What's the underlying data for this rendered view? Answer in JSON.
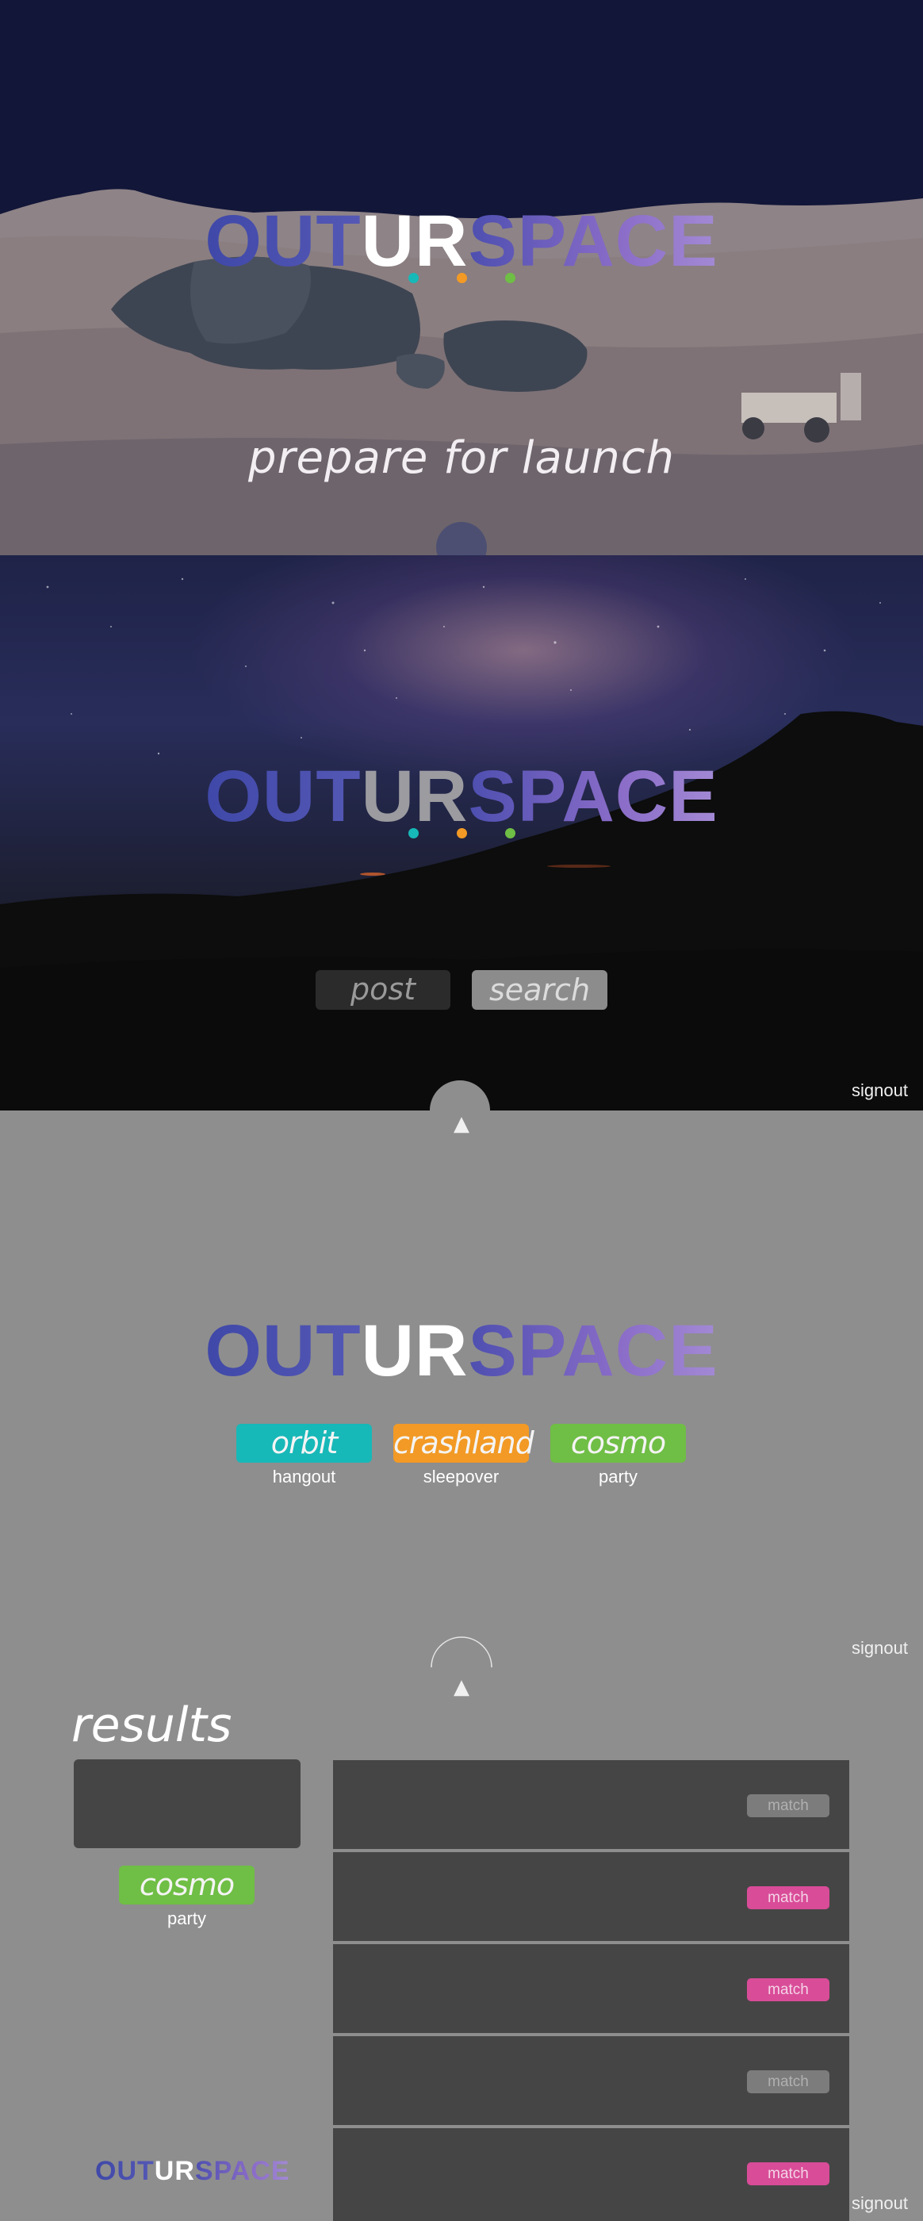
{
  "logo": {
    "part1": "OUT",
    "part2": "UR",
    "part3": "SPACE"
  },
  "colors": {
    "teal": "#17b8b8",
    "orange": "#f29a25",
    "green": "#6fbe45",
    "pink": "#d94c98",
    "match_inactive": "#7c7c7c",
    "panel_gray": "#8e8e8e",
    "row_dark": "#454545"
  },
  "hero": {
    "tagline": "prepare for launch"
  },
  "launch": {
    "post_label": "post",
    "search_label": "search",
    "signout": "signout"
  },
  "icons": {
    "scroll_up": "chevron-up-icon"
  },
  "categories": {
    "items": [
      {
        "label": "orbit",
        "sub": "hangout",
        "color": "#17b8b8"
      },
      {
        "label": "crashland",
        "sub": "sleepover",
        "color": "#f29a25"
      },
      {
        "label": "cosmo",
        "sub": "party",
        "color": "#6fbe45"
      }
    ],
    "signout": "signout"
  },
  "results": {
    "title": "results",
    "selected": {
      "label": "cosmo",
      "sub": "party"
    },
    "rows": [
      {
        "match": "match",
        "active": false
      },
      {
        "match": "match",
        "active": true
      },
      {
        "match": "match",
        "active": true
      },
      {
        "match": "match",
        "active": false
      },
      {
        "match": "match",
        "active": true
      }
    ],
    "signout": "signout"
  }
}
